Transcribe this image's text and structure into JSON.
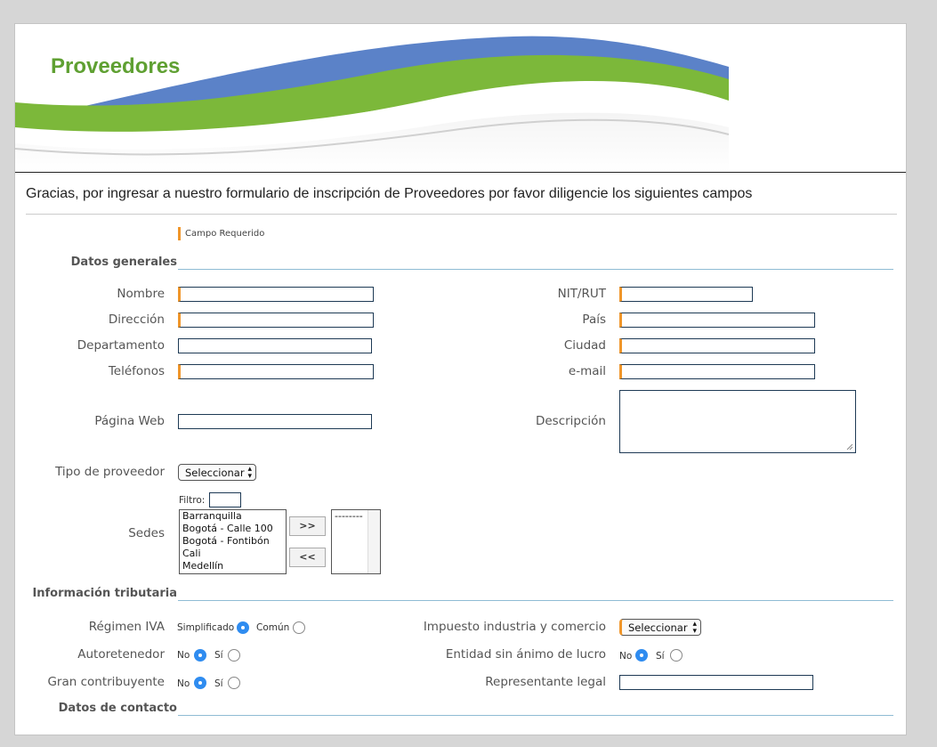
{
  "header": {
    "title": "Proveedores"
  },
  "intro": "Gracias, por ingresar a nuestro formulario de inscripción de Proveedores por favor diligencie los siguientes campos",
  "legend": "Campo Requerido",
  "sections": {
    "general": "Datos generales",
    "tax": "Información tributaria",
    "contact": "Datos de contacto"
  },
  "fields": {
    "nombre": "Nombre",
    "nit": "NIT/RUT",
    "direccion": "Dirección",
    "pais": "País",
    "departamento": "Departamento",
    "ciudad": "Ciudad",
    "telefonos": "Teléfonos",
    "email": "e-mail",
    "pagina_web": "Página Web",
    "descripcion": "Descripción",
    "tipo_proveedor": "Tipo de proveedor",
    "sedes": "Sedes",
    "regimen_iva": "Régimen IVA",
    "impuesto_ic": "Impuesto industria y comercio",
    "autoretenedor": "Autoretenedor",
    "entidad_sin_animo": "Entidad sin ánimo de lucro",
    "gran_contribuyente": "Gran contribuyente",
    "representante_legal": "Representante legal"
  },
  "selects": {
    "tipo_proveedor": "Seleccionar",
    "impuesto_ic": "Seleccionar"
  },
  "sedes": {
    "filter_label": "Filtro:",
    "available": [
      "Barranquilla",
      "Bogotá - Calle 100",
      "Bogotá - Fontibón",
      "Cali",
      "Medellín"
    ],
    "selected": [
      "--------"
    ],
    "add_label": ">>",
    "remove_label": "<<"
  },
  "radios": {
    "regimen": {
      "option_a": "Simplificado",
      "option_b": "Común",
      "selected": "Simplificado"
    },
    "autoretenedor": {
      "option_a": "No",
      "option_b": "Sí",
      "selected": "No"
    },
    "entidad": {
      "option_a": "No",
      "option_b": "Sí",
      "selected": "No"
    },
    "gran": {
      "option_a": "No",
      "option_b": "Sí",
      "selected": "No"
    }
  },
  "colors": {
    "brand_green": "#5fa032",
    "brand_blue": "#5b82c8",
    "required_orange": "#f0962a",
    "radio_blue": "#2f8cf0"
  }
}
